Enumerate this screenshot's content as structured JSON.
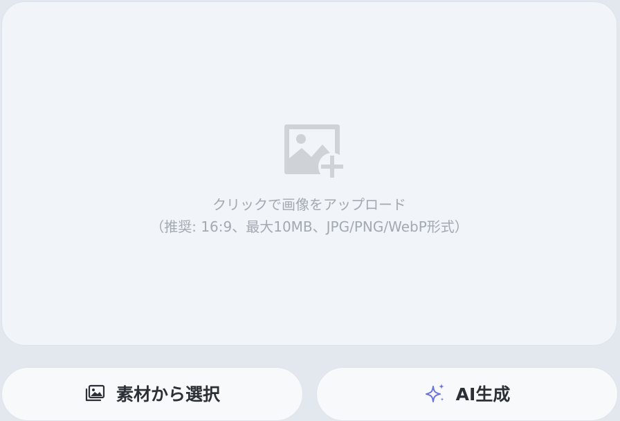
{
  "upload": {
    "icon": "image-add-icon",
    "primary_text": "クリックで画像をアップロード",
    "secondary_text": "（推奨: 16:9、最大10MB、JPG/PNG/WebP形式）"
  },
  "buttons": {
    "materials": {
      "label": "素材から選択",
      "icon": "image-gallery-icon"
    },
    "ai": {
      "label": "AI生成",
      "icon": "sparkles-icon",
      "icon_color": "#6b72e0"
    }
  },
  "colors": {
    "background": "#e2e8ee",
    "panel": "#f1f4f8",
    "placeholder_icon": "#cfd3d8",
    "placeholder_text": "#a3a9b1",
    "button_bg": "#f8f9fb",
    "button_text": "#2b2f36"
  }
}
